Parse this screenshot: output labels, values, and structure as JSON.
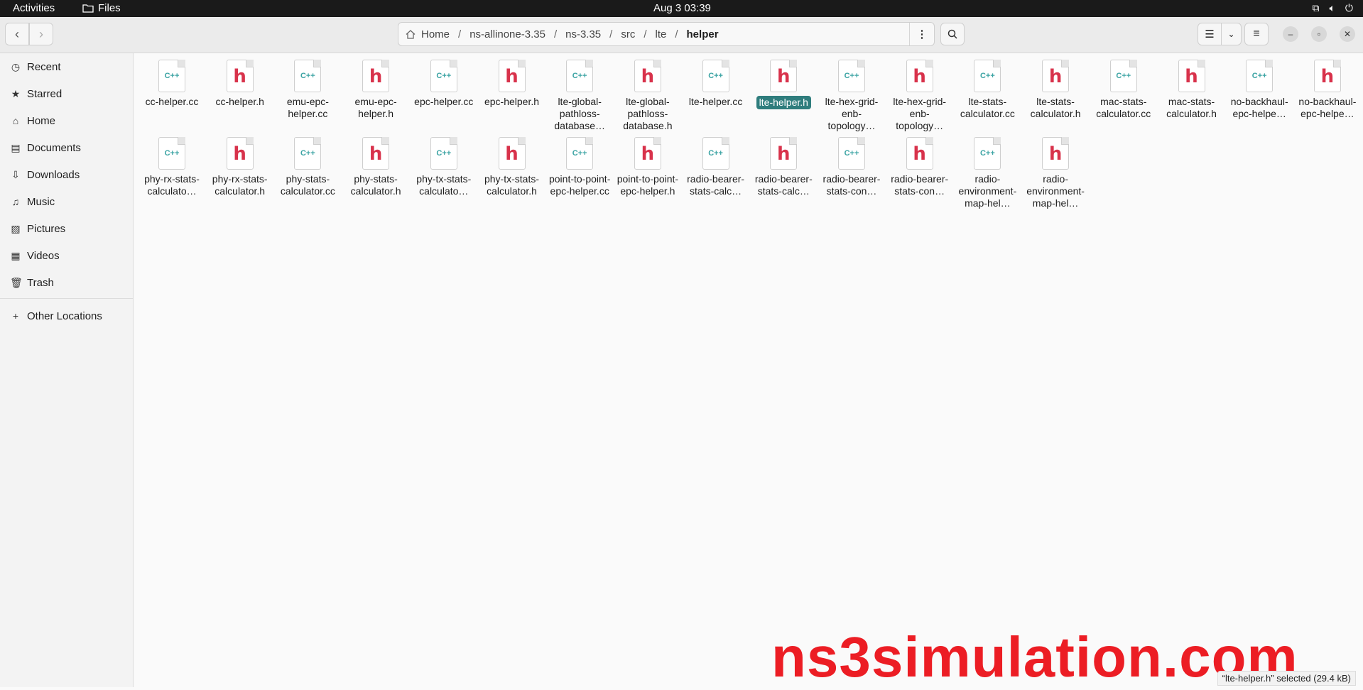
{
  "topbar": {
    "activities": "Activities",
    "app_name": "Files",
    "clock": "Aug 3  03:39"
  },
  "path": {
    "segments": [
      "Home",
      "ns-allinone-3.35",
      "ns-3.35",
      "src",
      "lte",
      "helper"
    ],
    "separator": "/"
  },
  "sidebar": {
    "items": [
      {
        "label": "Recent",
        "icon": "clock-icon"
      },
      {
        "label": "Starred",
        "icon": "star-icon"
      },
      {
        "label": "Home",
        "icon": "home-icon"
      },
      {
        "label": "Documents",
        "icon": "document-icon"
      },
      {
        "label": "Downloads",
        "icon": "download-icon"
      },
      {
        "label": "Music",
        "icon": "music-icon"
      },
      {
        "label": "Pictures",
        "icon": "picture-icon"
      },
      {
        "label": "Videos",
        "icon": "video-icon"
      },
      {
        "label": "Trash",
        "icon": "trash-icon"
      }
    ],
    "other_locations": "Other Locations"
  },
  "files": [
    {
      "name": "cc-helper.cc",
      "type": "cpp"
    },
    {
      "name": "cc-helper.h",
      "type": "h"
    },
    {
      "name": "emu-epc-helper.cc",
      "type": "cpp"
    },
    {
      "name": "emu-epc-helper.h",
      "type": "h"
    },
    {
      "name": "epc-helper.cc",
      "type": "cpp"
    },
    {
      "name": "epc-helper.h",
      "type": "h"
    },
    {
      "name": "lte-global-pathloss-database…",
      "type": "cpp"
    },
    {
      "name": "lte-global-pathloss-database.h",
      "type": "h"
    },
    {
      "name": "lte-helper.cc",
      "type": "cpp"
    },
    {
      "name": "lte-helper.h",
      "type": "h",
      "selected": true
    },
    {
      "name": "lte-hex-grid-enb-topology…",
      "type": "cpp"
    },
    {
      "name": "lte-hex-grid-enb-topology…",
      "type": "h"
    },
    {
      "name": "lte-stats-calculator.cc",
      "type": "cpp"
    },
    {
      "name": "lte-stats-calculator.h",
      "type": "h"
    },
    {
      "name": "mac-stats-calculator.cc",
      "type": "cpp"
    },
    {
      "name": "mac-stats-calculator.h",
      "type": "h"
    },
    {
      "name": "no-backhaul-epc-helpe…",
      "type": "cpp"
    },
    {
      "name": "no-backhaul-epc-helpe…",
      "type": "h"
    },
    {
      "name": "phy-rx-stats-calculato…",
      "type": "cpp"
    },
    {
      "name": "phy-rx-stats-calculator.h",
      "type": "h"
    },
    {
      "name": "phy-stats-calculator.cc",
      "type": "cpp"
    },
    {
      "name": "phy-stats-calculator.h",
      "type": "h"
    },
    {
      "name": "phy-tx-stats-calculato…",
      "type": "cpp"
    },
    {
      "name": "phy-tx-stats-calculator.h",
      "type": "h"
    },
    {
      "name": "point-to-point-epc-helper.cc",
      "type": "cpp"
    },
    {
      "name": "point-to-point-epc-helper.h",
      "type": "h"
    },
    {
      "name": "radio-bearer-stats-calc…",
      "type": "cpp"
    },
    {
      "name": "radio-bearer-stats-calc…",
      "type": "h"
    },
    {
      "name": "radio-bearer-stats-con…",
      "type": "cpp"
    },
    {
      "name": "radio-bearer-stats-con…",
      "type": "h"
    },
    {
      "name": "radio-environment-map-hel…",
      "type": "cpp"
    },
    {
      "name": "radio-environment-map-hel…",
      "type": "h"
    }
  ],
  "icon_text": {
    "cpp": "C++",
    "h": "h"
  },
  "watermark": "ns3simulation.com",
  "status": "“lte-helper.h” selected  (29.4 kB)",
  "colors": {
    "selection": "#2f7d7d",
    "h_icon": "#d8324b",
    "cpp_icon": "#3aa3a3",
    "watermark": "#ec1d24"
  }
}
